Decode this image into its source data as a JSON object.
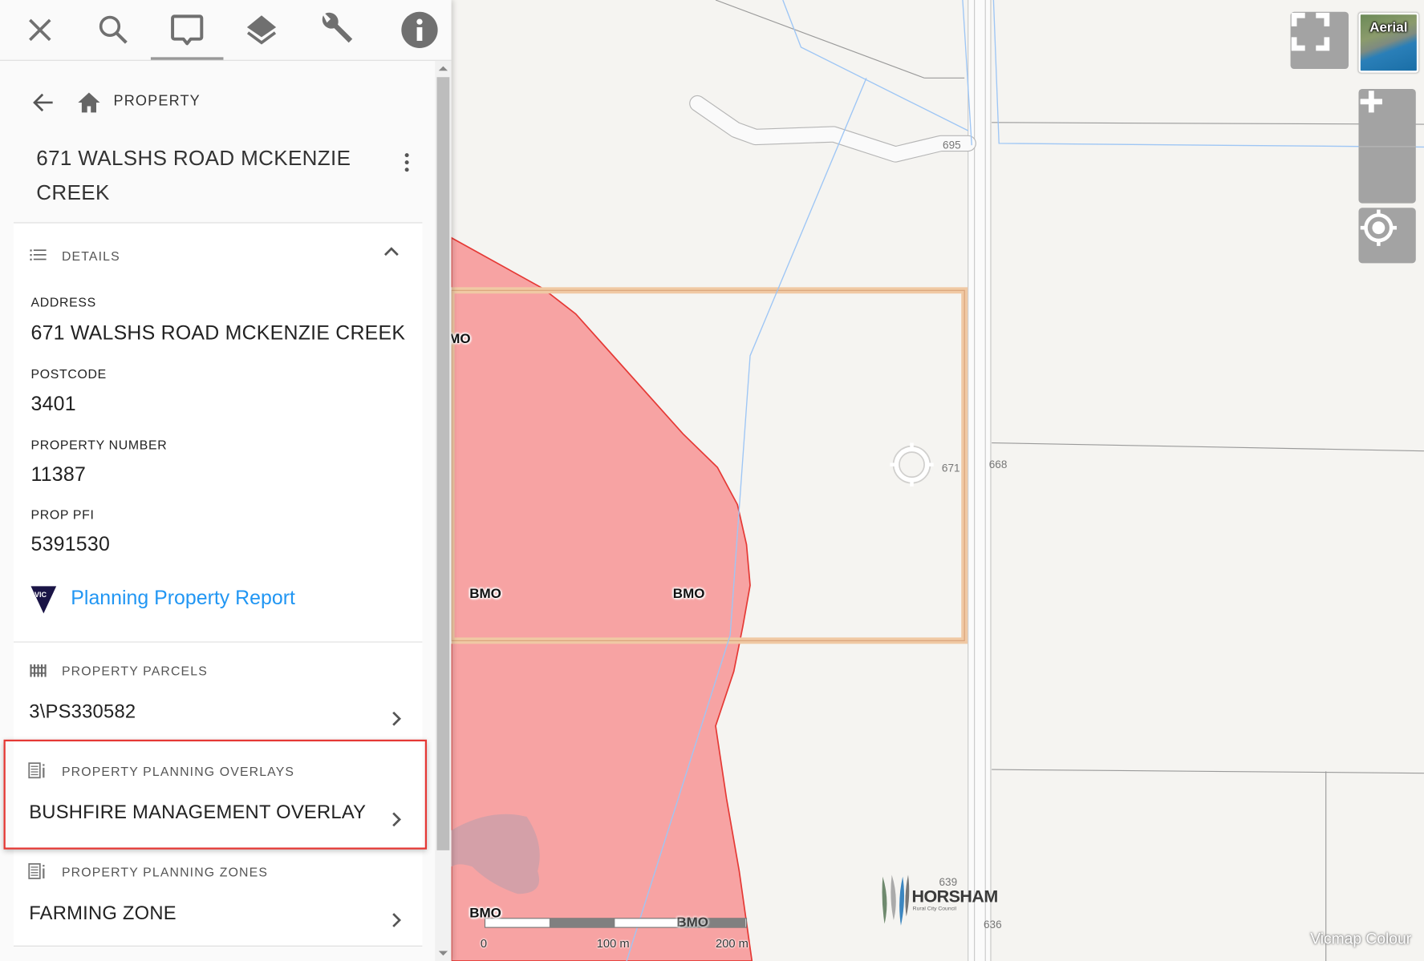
{
  "toolbar": {
    "items": [
      {
        "name": "close",
        "icon": "close-icon"
      },
      {
        "name": "search",
        "icon": "search-icon"
      },
      {
        "name": "identify",
        "icon": "speech-bubble-icon",
        "active": true
      },
      {
        "name": "layers",
        "icon": "layers-icon"
      },
      {
        "name": "tools",
        "icon": "wrench-icon"
      },
      {
        "name": "info",
        "icon": "info-icon"
      }
    ]
  },
  "breadcrumb": {
    "back_icon": "arrow-left-icon",
    "home_icon": "home-icon",
    "label": "PROPERTY"
  },
  "property": {
    "title_line1": "671 WALSHS ROAD MCKENZIE",
    "title_line2": "CREEK",
    "menu_icon": "more-vert-icon"
  },
  "details": {
    "heading": "DETAILS",
    "icon": "list-icon",
    "collapse_icon": "chevron-up-icon",
    "fields": [
      {
        "label": "ADDRESS",
        "value": "671 WALSHS ROAD MCKENZIE CREEK"
      },
      {
        "label": "POSTCODE",
        "value": "3401"
      },
      {
        "label": "PROPERTY NUMBER",
        "value": "11387"
      },
      {
        "label": "PROP PFI",
        "value": "5391530"
      }
    ],
    "report_link": "Planning Property Report",
    "report_logo_text": "VIC"
  },
  "parcels": {
    "heading": "PROPERTY PARCELS",
    "icon": "fence-icon",
    "value": "3\\PS330582"
  },
  "overlays": {
    "heading": "PROPERTY PLANNING OVERLAYS",
    "icon": "document-info-icon",
    "value": "BUSHFIRE MANAGEMENT OVERLAY",
    "highlighted": true
  },
  "zones": {
    "heading": "PROPERTY PLANNING ZONES",
    "icon": "document-info-icon",
    "value": "FARMING ZONE"
  },
  "map": {
    "basemap_toggle": "Aerial",
    "attribution": "Vicmap Colour",
    "controls": [
      "fullscreen",
      "zoom-in",
      "zoom-out",
      "locate"
    ],
    "overlay_labels": [
      "MO",
      "BMO",
      "BMO",
      "BMO",
      "BMO"
    ],
    "address_labels": [
      "695",
      "671",
      "668",
      "639",
      "636"
    ],
    "scale_labels": [
      "0",
      "100 m",
      "200 m"
    ],
    "council_logo": {
      "name": "HORSHAM",
      "subtitle": "Rural City Council"
    },
    "colors": {
      "overlay_fill": "#f7a3a3",
      "overlay_stroke": "#e53935",
      "parcel_highlight": "#f0c9a4",
      "water": "#9ec6f5",
      "background": "#f5f4f1"
    }
  }
}
